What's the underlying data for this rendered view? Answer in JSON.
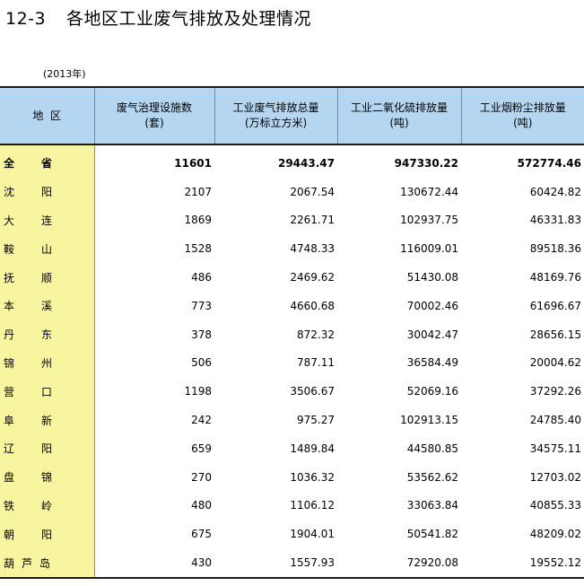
{
  "title": {
    "number": "12-3",
    "text": "各地区工业废气排放及处理情况"
  },
  "year": "(2013年)",
  "headers": [
    "地  区",
    "废气治理设施数\n(套)",
    "工业废气排放总量\n(万标立方米)",
    "工业二氧化硫排放量\n(吨)",
    "工业烟粉尘排放量\n(吨)"
  ],
  "rows": [
    {
      "name": "全省",
      "facilities": "11601",
      "exhaust": "29443.47",
      "so2": "947330.22",
      "dust": "572774.46"
    },
    {
      "name": "沈阳",
      "facilities": "2107",
      "exhaust": "2067.54",
      "so2": "130672.44",
      "dust": "60424.82"
    },
    {
      "name": "大连",
      "facilities": "1869",
      "exhaust": "2261.71",
      "so2": "102937.75",
      "dust": "46331.83"
    },
    {
      "name": "鞍山",
      "facilities": "1528",
      "exhaust": "4748.33",
      "so2": "116009.01",
      "dust": "89518.36"
    },
    {
      "name": "抚顺",
      "facilities": "486",
      "exhaust": "2469.62",
      "so2": "51430.08",
      "dust": "48169.76"
    },
    {
      "name": "本溪",
      "facilities": "773",
      "exhaust": "4660.68",
      "so2": "70002.46",
      "dust": "61696.67"
    },
    {
      "name": "丹东",
      "facilities": "378",
      "exhaust": "872.32",
      "so2": "30042.47",
      "dust": "28656.15"
    },
    {
      "name": "锦州",
      "facilities": "506",
      "exhaust": "787.11",
      "so2": "36584.49",
      "dust": "20004.62"
    },
    {
      "name": "营口",
      "facilities": "1198",
      "exhaust": "3506.67",
      "so2": "52069.16",
      "dust": "37292.26"
    },
    {
      "name": "阜新",
      "facilities": "242",
      "exhaust": "975.27",
      "so2": "102913.15",
      "dust": "24785.40"
    },
    {
      "name": "辽阳",
      "facilities": "659",
      "exhaust": "1489.84",
      "so2": "44580.85",
      "dust": "34575.11"
    },
    {
      "name": "盘锦",
      "facilities": "270",
      "exhaust": "1036.32",
      "so2": "53562.62",
      "dust": "12703.02"
    },
    {
      "name": "铁岭",
      "facilities": "480",
      "exhaust": "1106.12",
      "so2": "33063.84",
      "dust": "40855.33"
    },
    {
      "name": "朝阳",
      "facilities": "675",
      "exhaust": "1904.01",
      "so2": "50541.82",
      "dust": "48209.02"
    },
    {
      "name": "葫芦岛",
      "facilities": "430",
      "exhaust": "1557.93",
      "so2": "72920.08",
      "dust": "19552.12"
    }
  ]
}
